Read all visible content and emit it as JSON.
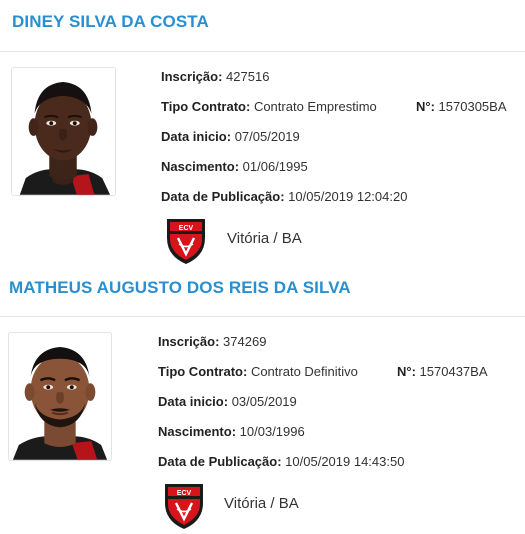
{
  "players": [
    {
      "name": "DINEY SILVA DA COSTA",
      "inscricao_label": "Inscrição:",
      "inscricao": "427516",
      "tipo_label": "Tipo Contrato:",
      "tipo": "Contrato Emprestimo",
      "num_label": "N°:",
      "num": "1570305BA",
      "inicio_label": "Data inicio:",
      "inicio": "07/05/2019",
      "nascimento_label": "Nascimento:",
      "nascimento": "01/06/1995",
      "publicacao_label": "Data de Publicação:",
      "publicacao": "10/05/2019 12:04:20",
      "club": "Vitória / BA",
      "crest_icon": "vitoria-crest-icon"
    },
    {
      "name": "MATHEUS AUGUSTO DOS REIS DA SILVA",
      "inscricao_label": "Inscrição:",
      "inscricao": "374269",
      "tipo_label": "Tipo Contrato:",
      "tipo": "Contrato Definitivo",
      "num_label": "N°:",
      "num": "1570437BA",
      "inicio_label": "Data inicio:",
      "inicio": "03/05/2019",
      "nascimento_label": "Nascimento:",
      "nascimento": "10/03/1996",
      "publicacao_label": "Data de Publicação:",
      "publicacao": "10/05/2019 14:43:50",
      "club": "Vitória / BA",
      "crest_icon": "vitoria-crest-icon"
    }
  ],
  "colors": {
    "name_blue": "#2a8fd1",
    "crest_red": "#d7141a",
    "crest_black": "#1a1a1a"
  }
}
